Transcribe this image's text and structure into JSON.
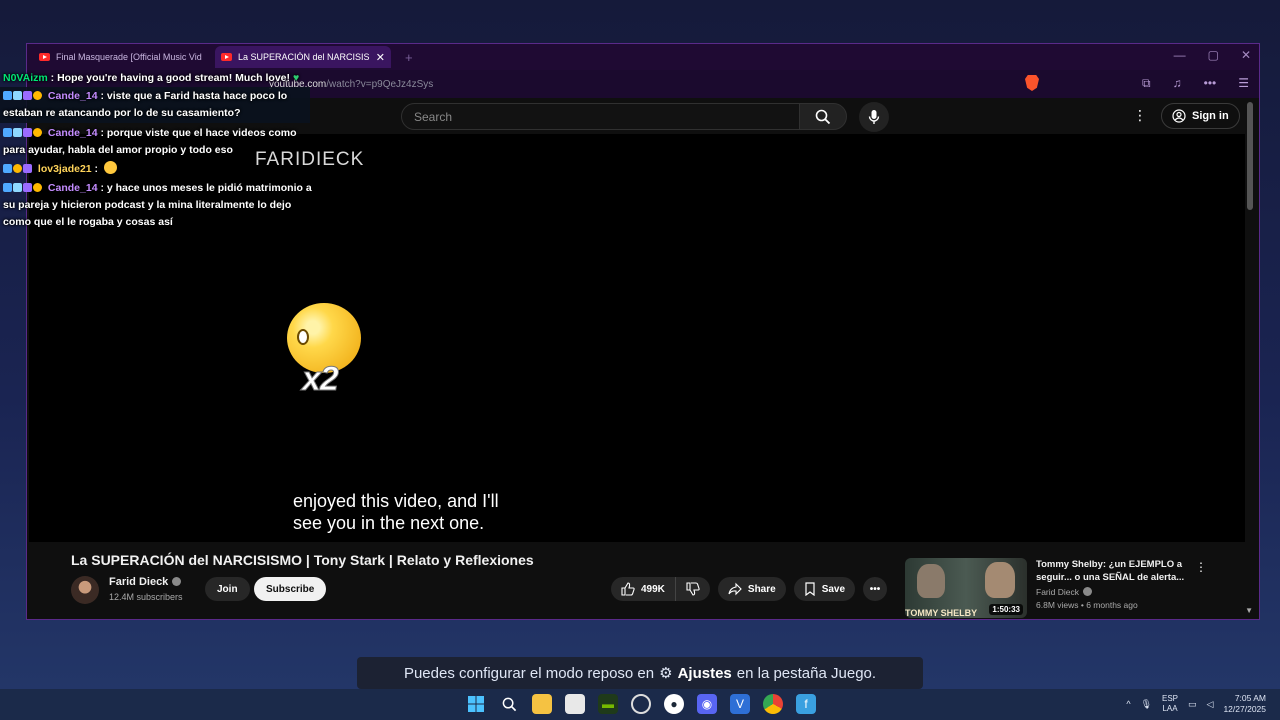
{
  "browser": {
    "tabs": [
      {
        "title": "Final Masquerade [Official Music Vid",
        "active": false
      },
      {
        "title": "La SUPERACIÓN del NARCISISMO",
        "active": true
      }
    ],
    "new_tab_label": "+",
    "url_prefix": "youtube.com",
    "url_path": "/watch?v=p9QeJz4zSys",
    "window_controls": {
      "minimize": "—",
      "maximize": "▢",
      "close": "✕"
    }
  },
  "youtube": {
    "search_placeholder": "Search",
    "sign_in_label": "Sign in",
    "video": {
      "watermark": "FARIDIECK",
      "caption": "enjoyed this video, and I'll\nsee you in the next one.",
      "title": "La SUPERACIÓN del NARCISISMO | Tony Stark | Relato y Reflexiones"
    },
    "channel": {
      "name": "Farid Dieck",
      "subscribers": "12.4M subscribers",
      "join_label": "Join",
      "subscribe_label": "Subscribe"
    },
    "actions": {
      "likes": "499K",
      "share_label": "Share",
      "save_label": "Save"
    },
    "recommendation": {
      "title": "Tommy Shelby: ¿un EJEMPLO a seguir... o una SEÑAL de alerta...",
      "channel": "Farid Dieck",
      "meta": "6.8M views • 6 months ago",
      "duration": "1:50:33",
      "thumb_text": "TOMMY SHELBY"
    }
  },
  "chat": {
    "messages": [
      {
        "user": "N0VAizm",
        "text": ": Hope you're having a good stream! Much love!"
      },
      {
        "user": "Cande_14",
        "text": ": viste que a Farid hasta hace poco lo estaban re atancando por lo de su casamiento?"
      },
      {
        "user": "Cande_14",
        "text": ": porque viste que el hace videos como para ayudar, habla del amor propio y todo eso"
      },
      {
        "user": "lov3jade21",
        "text": ":"
      },
      {
        "user": "Cande_14",
        "text": ": y hace unos meses le pidió matrimonio a su pareja y hicieron podcast y la mina literalmente lo dejo como que el le rogaba y cosas así"
      }
    ],
    "emote_multiplier": "x2"
  },
  "toast": {
    "prefix": "Puedes configurar el modo reposo en",
    "bold": "Ajustes",
    "suffix": "en la pestaña Juego."
  },
  "taskbar": {
    "lang_1": "ESP",
    "lang_2": "LAA",
    "time": "7:05 AM",
    "date": "12/27/2025"
  }
}
